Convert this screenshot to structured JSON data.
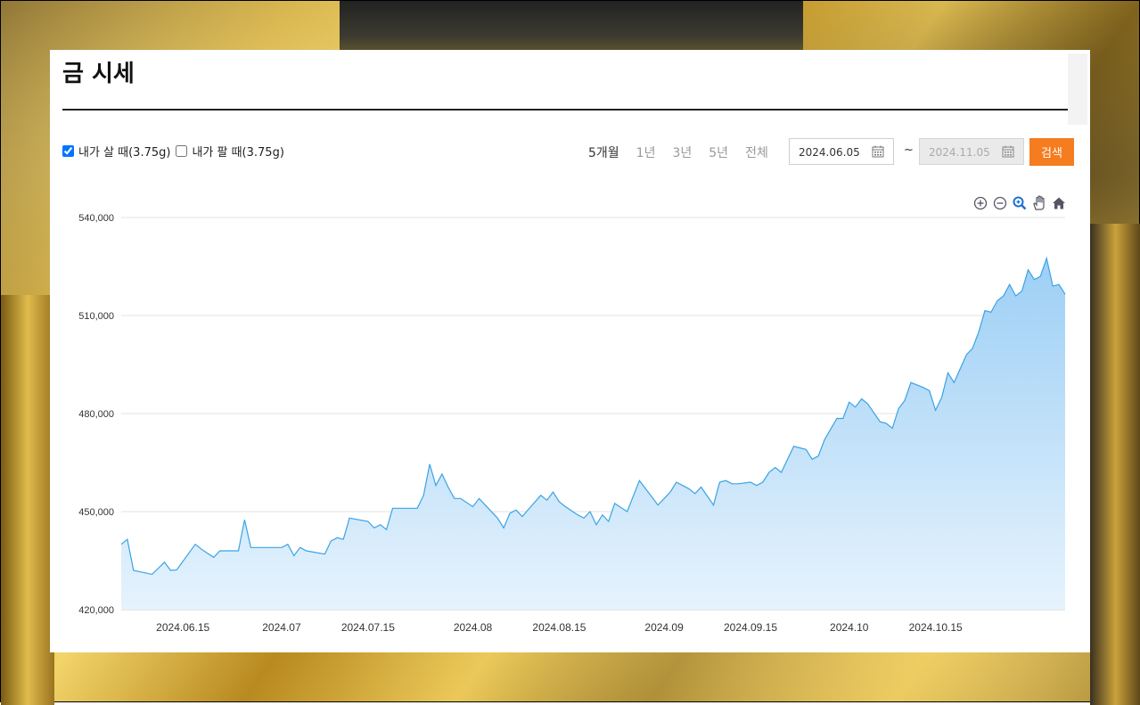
{
  "page": {
    "title": "금 시세"
  },
  "controls": {
    "buy_label": "내가 살 때(3.75g)",
    "buy_checked": true,
    "sell_label": "내가 팔 때(3.75g)",
    "sell_checked": false,
    "periods": [
      "5개월",
      "1년",
      "3년",
      "5년",
      "전체"
    ],
    "active_period": "5개월",
    "date_from": "2024.06.05",
    "date_to": "2024.11.05",
    "tilde": "~",
    "search_label": "검색"
  },
  "toolbox": [
    "zoom-in-icon",
    "zoom-out-icon",
    "magnifier-icon",
    "pan-hand-icon",
    "home-icon"
  ],
  "colors": {
    "accent": "#f57c1f",
    "line": "#3aa3e3",
    "area_top": "#9dcff5",
    "area_bottom": "#e6f3fd"
  },
  "chart_data": {
    "type": "area",
    "title": "",
    "xlabel": "",
    "ylabel": "",
    "ylim": [
      420000,
      540000
    ],
    "yticks": [
      420000,
      450000,
      480000,
      510000,
      540000
    ],
    "ytick_labels": [
      "420,000",
      "450,000",
      "480,000",
      "510,000",
      "540,000"
    ],
    "xticks": [
      "2024-06-15",
      "2024-07-01",
      "2024-07-15",
      "2024-08-01",
      "2024-08-15",
      "2024-09-01",
      "2024-09-15",
      "2024-10-01",
      "2024-10-15"
    ],
    "xtick_labels": [
      "2024.06.15",
      "2024.07",
      "2024.07.15",
      "2024.08",
      "2024.08.15",
      "2024.09",
      "2024.09.15",
      "2024.10",
      "2024.10.15"
    ],
    "grid": true,
    "series": [
      {
        "values": [
          [
            "2024-06-05",
            440000
          ],
          [
            "2024-06-06",
            441500
          ],
          [
            "2024-06-07",
            432000
          ],
          [
            "2024-06-10",
            430800
          ],
          [
            "2024-06-12",
            434500
          ],
          [
            "2024-06-13",
            432000
          ],
          [
            "2024-06-14",
            432200
          ],
          [
            "2024-06-17",
            440000
          ],
          [
            "2024-06-18",
            438500
          ],
          [
            "2024-06-19",
            437200
          ],
          [
            "2024-06-20",
            436000
          ],
          [
            "2024-06-21",
            438000
          ],
          [
            "2024-06-24",
            438000
          ],
          [
            "2024-06-25",
            447500
          ],
          [
            "2024-06-26",
            439000
          ],
          [
            "2024-06-28",
            439000
          ],
          [
            "2024-07-01",
            439000
          ],
          [
            "2024-07-02",
            440000
          ],
          [
            "2024-07-03",
            436500
          ],
          [
            "2024-07-04",
            439000
          ],
          [
            "2024-07-05",
            438000
          ],
          [
            "2024-07-08",
            437000
          ],
          [
            "2024-07-09",
            441000
          ],
          [
            "2024-07-10",
            442000
          ],
          [
            "2024-07-11",
            441500
          ],
          [
            "2024-07-12",
            448000
          ],
          [
            "2024-07-15",
            447000
          ],
          [
            "2024-07-16",
            445000
          ],
          [
            "2024-07-17",
            446000
          ],
          [
            "2024-07-18",
            444500
          ],
          [
            "2024-07-19",
            451000
          ],
          [
            "2024-07-22",
            451000
          ],
          [
            "2024-07-23",
            451000
          ],
          [
            "2024-07-24",
            455000
          ],
          [
            "2024-07-25",
            464500
          ],
          [
            "2024-07-26",
            458000
          ],
          [
            "2024-07-27",
            461500
          ],
          [
            "2024-07-28",
            457500
          ],
          [
            "2024-07-29",
            454000
          ],
          [
            "2024-07-30",
            454000
          ],
          [
            "2024-08-01",
            451500
          ],
          [
            "2024-08-02",
            454000
          ],
          [
            "2024-08-05",
            448000
          ],
          [
            "2024-08-06",
            445000
          ],
          [
            "2024-08-07",
            449500
          ],
          [
            "2024-08-08",
            450500
          ],
          [
            "2024-08-09",
            448500
          ],
          [
            "2024-08-12",
            455000
          ],
          [
            "2024-08-13",
            453500
          ],
          [
            "2024-08-14",
            456000
          ],
          [
            "2024-08-15",
            453000
          ],
          [
            "2024-08-16",
            451500
          ],
          [
            "2024-08-18",
            449000
          ],
          [
            "2024-08-19",
            448000
          ],
          [
            "2024-08-20",
            450000
          ],
          [
            "2024-08-21",
            446000
          ],
          [
            "2024-08-22",
            449000
          ],
          [
            "2024-08-23",
            447000
          ],
          [
            "2024-08-24",
            452500
          ],
          [
            "2024-08-26",
            450000
          ],
          [
            "2024-08-28",
            459500
          ],
          [
            "2024-08-29",
            457000
          ],
          [
            "2024-08-31",
            452000
          ],
          [
            "2024-09-02",
            456000
          ],
          [
            "2024-09-03",
            459000
          ],
          [
            "2024-09-04",
            458000
          ],
          [
            "2024-09-05",
            457000
          ],
          [
            "2024-09-06",
            455500
          ],
          [
            "2024-09-07",
            457500
          ],
          [
            "2024-09-09",
            452000
          ],
          [
            "2024-09-10",
            459000
          ],
          [
            "2024-09-11",
            459500
          ],
          [
            "2024-09-12",
            458500
          ],
          [
            "2024-09-13",
            458500
          ],
          [
            "2024-09-15",
            459000
          ],
          [
            "2024-09-16",
            458000
          ],
          [
            "2024-09-17",
            459000
          ],
          [
            "2024-09-18",
            462000
          ],
          [
            "2024-09-19",
            463500
          ],
          [
            "2024-09-20",
            462000
          ],
          [
            "2024-09-22",
            470000
          ],
          [
            "2024-09-23",
            469500
          ],
          [
            "2024-09-24",
            469000
          ],
          [
            "2024-09-25",
            466000
          ],
          [
            "2024-09-26",
            467000
          ],
          [
            "2024-09-27",
            472000
          ],
          [
            "2024-09-29",
            478500
          ],
          [
            "2024-09-30",
            478500
          ],
          [
            "2024-10-01",
            483500
          ],
          [
            "2024-10-02",
            482000
          ],
          [
            "2024-10-03",
            484500
          ],
          [
            "2024-10-04",
            483000
          ],
          [
            "2024-10-06",
            477500
          ],
          [
            "2024-10-07",
            477000
          ],
          [
            "2024-10-08",
            475500
          ],
          [
            "2024-10-09",
            481500
          ],
          [
            "2024-10-10",
            484000
          ],
          [
            "2024-10-11",
            489500
          ],
          [
            "2024-10-13",
            488000
          ],
          [
            "2024-10-14",
            487000
          ],
          [
            "2024-10-15",
            481000
          ],
          [
            "2024-10-16",
            485000
          ],
          [
            "2024-10-17",
            492500
          ],
          [
            "2024-10-18",
            489500
          ],
          [
            "2024-10-20",
            498000
          ],
          [
            "2024-10-21",
            500000
          ],
          [
            "2024-10-22",
            505000
          ],
          [
            "2024-10-23",
            511500
          ],
          [
            "2024-10-24",
            511000
          ],
          [
            "2024-10-25",
            514500
          ],
          [
            "2024-10-26",
            516000
          ],
          [
            "2024-10-27",
            519500
          ],
          [
            "2024-10-28",
            516000
          ],
          [
            "2024-10-29",
            517500
          ],
          [
            "2024-10-30",
            524000
          ],
          [
            "2024-10-31",
            521000
          ],
          [
            "2024-11-01",
            522000
          ],
          [
            "2024-11-02",
            527500
          ],
          [
            "2024-11-03",
            519000
          ],
          [
            "2024-11-04",
            519500
          ],
          [
            "2024-11-05",
            516500
          ]
        ]
      }
    ]
  }
}
